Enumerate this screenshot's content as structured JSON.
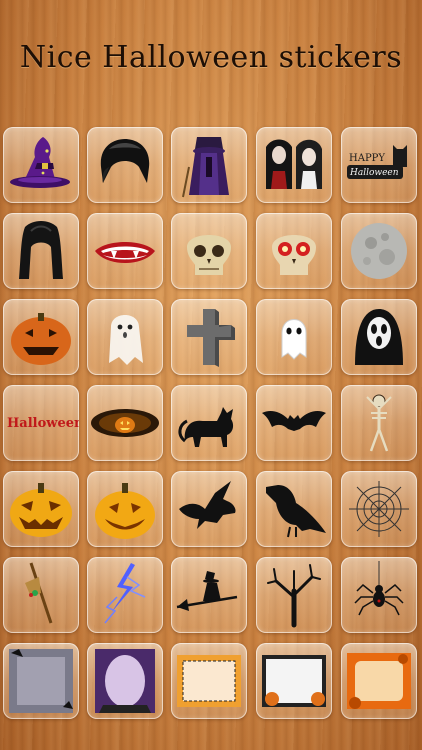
{
  "title": "Nice Halloween stickers",
  "stickers": [
    {
      "icon": "witch-hat-icon"
    },
    {
      "icon": "black-wig-icon"
    },
    {
      "icon": "witch-costume-icon"
    },
    {
      "icon": "vampire-couple-icon"
    },
    {
      "icon": "happy-halloween-text-icon",
      "text_line1": "HAPPY",
      "text_line2": "Halloween"
    },
    {
      "icon": "long-black-hair-icon"
    },
    {
      "icon": "vampire-mouth-icon"
    },
    {
      "icon": "skull-icon"
    },
    {
      "icon": "skull-red-eyes-icon"
    },
    {
      "icon": "full-moon-icon"
    },
    {
      "icon": "jack-o-lantern-icon"
    },
    {
      "icon": "white-ghost-icon"
    },
    {
      "icon": "gravestone-cross-icon"
    },
    {
      "icon": "small-ghost-icon"
    },
    {
      "icon": "scream-mask-icon"
    },
    {
      "icon": "halloween-red-text-icon",
      "text": "Halloween"
    },
    {
      "icon": "glowing-pumpkin-icon"
    },
    {
      "icon": "black-cat-icon"
    },
    {
      "icon": "bat-icon"
    },
    {
      "icon": "skeleton-icon"
    },
    {
      "icon": "glowing-jack-o-lantern-icon"
    },
    {
      "icon": "grinning-jack-o-lantern-icon"
    },
    {
      "icon": "flying-raven-icon"
    },
    {
      "icon": "perched-raven-icon"
    },
    {
      "icon": "spider-web-icon"
    },
    {
      "icon": "broom-icon"
    },
    {
      "icon": "lightning-icon"
    },
    {
      "icon": "witch-on-broom-icon"
    },
    {
      "icon": "dead-tree-icon"
    },
    {
      "icon": "spider-icon"
    },
    {
      "icon": "grey-frame-icon"
    },
    {
      "icon": "purple-frame-icon"
    },
    {
      "icon": "orange-border-frame-icon"
    },
    {
      "icon": "pumpkin-frame-icon"
    },
    {
      "icon": "orange-pumpkin-frame-icon"
    }
  ],
  "colors": {
    "wood": "#c9803f",
    "title_text": "#1d0f06",
    "halloween_red": "#c0181a"
  }
}
